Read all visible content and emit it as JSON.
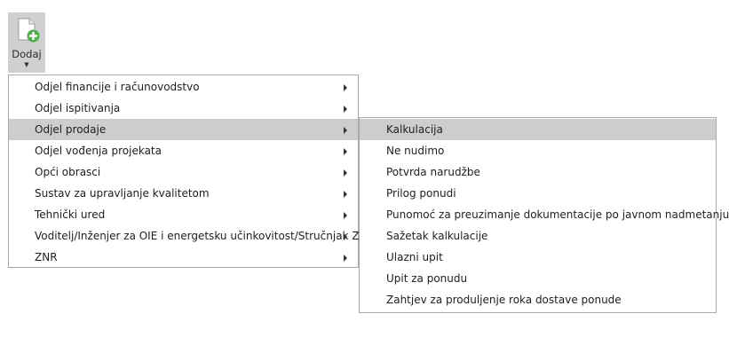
{
  "toolbar": {
    "add_label": "Dodaj",
    "add_icon": "new-document-plus-icon",
    "dropdown_icon": "caret-down-icon"
  },
  "main_menu": {
    "items": [
      {
        "label": "Odjel financije i računovodstvo",
        "has_submenu": true
      },
      {
        "label": "Odjel ispitivanja",
        "has_submenu": true
      },
      {
        "label": "Odjel prodaje",
        "has_submenu": true,
        "active": true
      },
      {
        "label": "Odjel vođenja projekata",
        "has_submenu": true
      },
      {
        "label": "Opći obrasci",
        "has_submenu": true
      },
      {
        "label": "Sustav za upravljanje kvalitetom",
        "has_submenu": true
      },
      {
        "label": "Tehnički ured",
        "has_submenu": true
      },
      {
        "label": "Voditelj/Inženjer za OIE i energetsku učinkovitost/Stručnjak ZNR",
        "has_submenu": true
      },
      {
        "label": "ZNR",
        "has_submenu": true
      }
    ]
  },
  "submenu": {
    "items": [
      {
        "label": "Kalkulacija",
        "active": true
      },
      {
        "label": "Ne nudimo"
      },
      {
        "label": "Potvrda narudžbe"
      },
      {
        "label": "Prilog ponudi"
      },
      {
        "label": "Punomoć za preuzimanje dokumentacije po javnom nadmetanju"
      },
      {
        "label": "Sažetak kalkulacije"
      },
      {
        "label": "Ulazni upit"
      },
      {
        "label": "Upit za ponudu"
      },
      {
        "label": "Zahtjev za produljenje roka dostave ponude"
      }
    ]
  },
  "colors": {
    "highlight": "#cdcdcd",
    "icon_green": "#4bb04b",
    "border": "#a9a9a9"
  }
}
